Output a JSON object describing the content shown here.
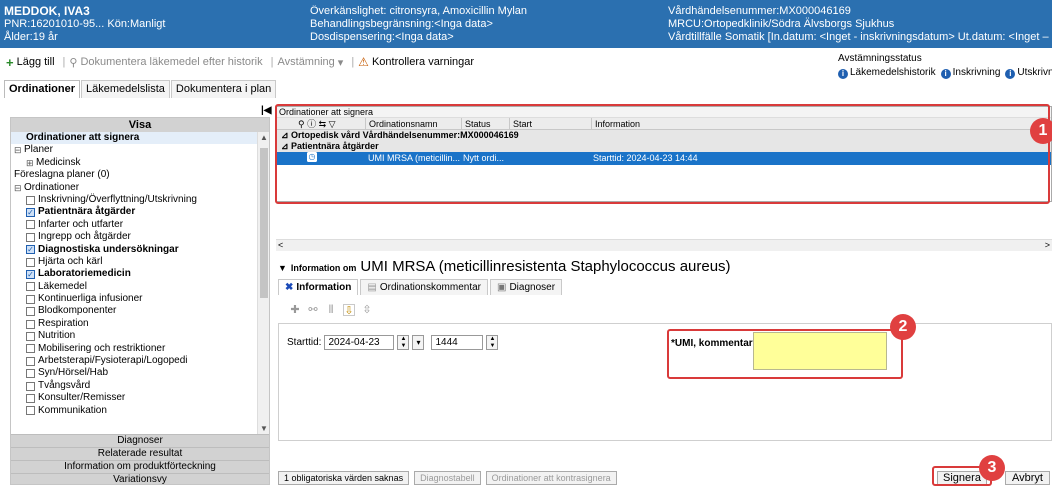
{
  "patient": {
    "name": "MEDDOK, IVA3",
    "pnr": "PNR:16201010-95...",
    "gender": "Kön:Manligt",
    "age": "Ålder:19 år",
    "allergy": "Överkänslighet: citronsyra, Amoxicillin Mylan",
    "treatment_limit": "Behandlingsbegränsning:<Inga data>",
    "dose_dispensing": "Dosdispensering:<Inga data>",
    "event_number": "Vårdhändelsenummer:MX000046169",
    "mrcu": "MRCU:Ortopedklinik/Södra Älvsborgs Sjukhus",
    "admission": "Vårdtillfälle Somatik [In.datum: <Inget - inskrivningsdatum> Ut.datum: <Inget – utskrivningsdatum..."
  },
  "toolbar": {
    "add": "Lägg till",
    "document_history": "Dokumentera läkemedel efter historik",
    "reconcile": "Avstämning",
    "check_warnings": "Kontrollera varningar"
  },
  "reconcile_status": {
    "title": "Avstämningsstatus",
    "items": [
      "Läkemedelshistorik",
      "Inskrivning",
      "Utskrivni"
    ]
  },
  "main_tabs": [
    "Ordinationer",
    "Läkemedelslista",
    "Dokumentera i plan"
  ],
  "left_panel": {
    "header": "Visa",
    "tree": [
      {
        "label": "Ordinationer att signera",
        "bold": true,
        "selected": true,
        "indent": 1,
        "type": "text"
      },
      {
        "label": "Planer",
        "indent": 0,
        "type": "expand",
        "exp": "⊟"
      },
      {
        "label": "Medicinsk",
        "indent": 1,
        "type": "expand",
        "exp": "⊞"
      },
      {
        "label": "Föreslagna planer (0)",
        "indent": 0,
        "type": "text"
      },
      {
        "label": "Ordinationer",
        "indent": 0,
        "type": "expand",
        "exp": "⊟"
      },
      {
        "label": "Inskrivning/Överflyttning/Utskrivning",
        "indent": 1,
        "type": "check",
        "checked": false
      },
      {
        "label": "Patientnära åtgärder",
        "indent": 1,
        "type": "check",
        "checked": true,
        "bold": true
      },
      {
        "label": "Infarter och utfarter",
        "indent": 1,
        "type": "check",
        "checked": false
      },
      {
        "label": "Ingrepp och åtgärder",
        "indent": 1,
        "type": "check",
        "checked": false
      },
      {
        "label": "Diagnostiska undersökningar",
        "indent": 1,
        "type": "check",
        "checked": true,
        "bold": true
      },
      {
        "label": "Hjärta och kärl",
        "indent": 1,
        "type": "check",
        "checked": false
      },
      {
        "label": "Laboratoriemedicin",
        "indent": 1,
        "type": "check",
        "checked": true,
        "bold": true
      },
      {
        "label": "Läkemedel",
        "indent": 1,
        "type": "check",
        "checked": false
      },
      {
        "label": "Kontinuerliga infusioner",
        "indent": 1,
        "type": "check",
        "checked": false
      },
      {
        "label": "Blodkomponenter",
        "indent": 1,
        "type": "check",
        "checked": false
      },
      {
        "label": "Respiration",
        "indent": 1,
        "type": "check",
        "checked": false
      },
      {
        "label": "Nutrition",
        "indent": 1,
        "type": "check",
        "checked": false
      },
      {
        "label": "Mobilisering och restriktioner",
        "indent": 1,
        "type": "check",
        "checked": false
      },
      {
        "label": "Arbetsterapi/Fysioterapi/Logopedi",
        "indent": 1,
        "type": "check",
        "checked": false
      },
      {
        "label": "Syn/Hörsel/Hab",
        "indent": 1,
        "type": "check",
        "checked": false
      },
      {
        "label": "Tvångsvård",
        "indent": 1,
        "type": "check",
        "checked": false
      },
      {
        "label": "Konsulter/Remisser",
        "indent": 1,
        "type": "check",
        "checked": false
      },
      {
        "label": "Kommunikation",
        "indent": 1,
        "type": "check",
        "checked": false
      }
    ],
    "accordions": [
      "Diagnoser",
      "Relaterade resultat",
      "Information om produktförteckning",
      "Variationsvy"
    ]
  },
  "orders_grid": {
    "title": "Ordinationer att signera",
    "columns": [
      "Ordinationsnamn",
      "Status",
      "Start",
      "Information"
    ],
    "group1": "Ortopedisk vård  Vårdhändelsenummer:MX000046169",
    "group2": "Patientnära åtgärder",
    "row": {
      "name": "UMI MRSA (meticillin...",
      "status": "Nytt ordi...",
      "info": "Starttid: 2024-04-23 14:44"
    }
  },
  "info_panel": {
    "prefix": "Information om",
    "title": "UMI MRSA (meticillinresistenta Staphylococcus aureus)",
    "tabs": [
      "Information",
      "Ordinationskommentar",
      "Diagnoser"
    ],
    "start_label": "Starttid:",
    "start_date": "2024-04-23",
    "start_time": "1444",
    "umi_label": "*UMI, kommentar:",
    "umi_value": ""
  },
  "bottom": {
    "missing_values": "1 obligatoriska värden saknas",
    "diagnosis_table": "Diagnostabell",
    "cosign": "Ordinationer att kontrasignera",
    "sign": "Signera",
    "cancel": "Avbryt"
  },
  "annotations": [
    "1",
    "2",
    "3"
  ],
  "colors": {
    "banner": "#2b70b0",
    "selected_row": "#1a73c8",
    "required_field": "#ffff99",
    "annotation": "#e04040"
  }
}
